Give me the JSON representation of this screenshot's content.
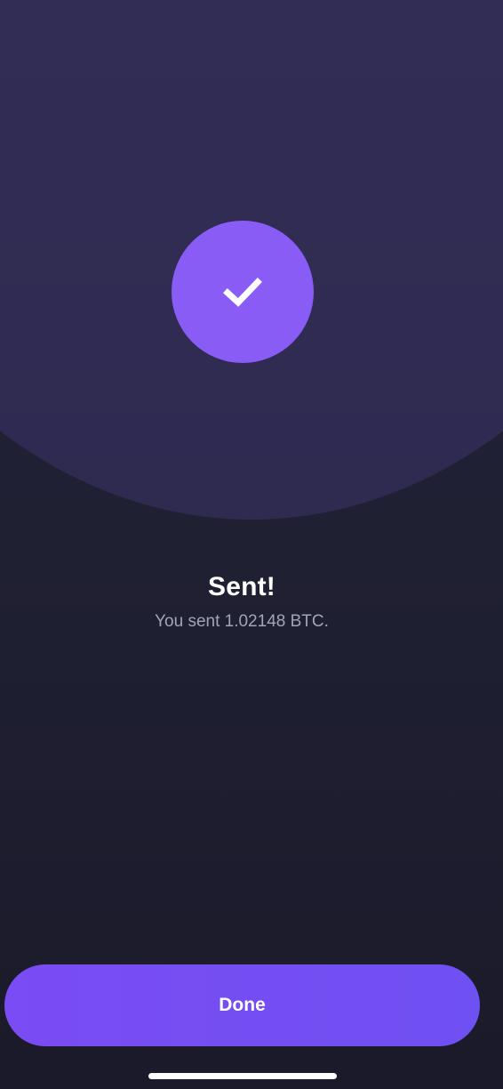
{
  "confirmation": {
    "title": "Sent!",
    "message": "You sent 1.02148 BTC.",
    "status_icon": "checkmark-icon"
  },
  "actions": {
    "done_label": "Done"
  },
  "colors": {
    "accent": "#8a5cf6",
    "button": "#7a4cf3",
    "background": "#1f1f32",
    "hero": "#332f58"
  }
}
